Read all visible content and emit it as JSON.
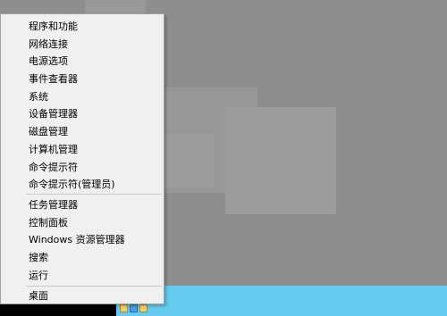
{
  "context_menu": {
    "items": [
      {
        "label": "程序和功能"
      },
      {
        "label": "网络连接"
      },
      {
        "label": "电源选项"
      },
      {
        "label": "事件查看器"
      },
      {
        "label": "系统"
      },
      {
        "label": "设备管理器"
      },
      {
        "label": "磁盘管理"
      },
      {
        "label": "计算机管理"
      },
      {
        "label": "命令提示符"
      },
      {
        "label": "命令提示符(管理员)"
      },
      {
        "label": "任务管理器"
      },
      {
        "label": "控制面板"
      },
      {
        "label": "Windows 资源管理器"
      },
      {
        "label": "搜索"
      },
      {
        "label": "运行"
      },
      {
        "label": "桌面"
      }
    ]
  },
  "colors": {
    "desktop": "#8e8e8e",
    "taskbar": "#66cbee",
    "menu_background": "#f0f0f0",
    "start_area": "#000000"
  }
}
